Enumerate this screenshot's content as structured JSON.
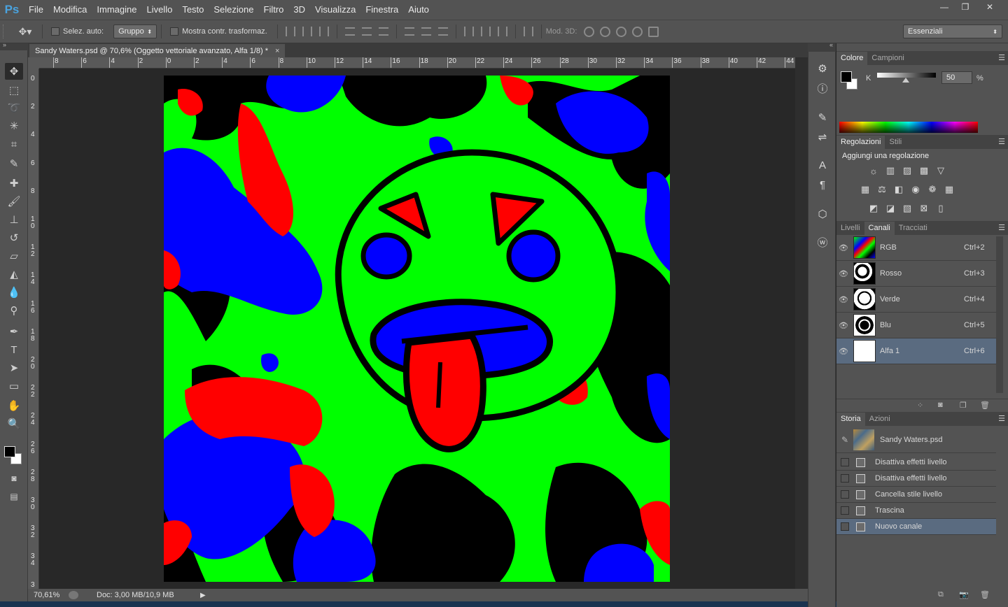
{
  "app": {
    "logo": "Ps"
  },
  "menubar": {
    "items": [
      "File",
      "Modifica",
      "Immagine",
      "Livello",
      "Testo",
      "Selezione",
      "Filtro",
      "3D",
      "Visualizza",
      "Finestra",
      "Aiuto"
    ]
  },
  "window_controls": {
    "minimize": "—",
    "restore": "❐",
    "close": "✕"
  },
  "options_bar": {
    "auto_select_label": "Selez. auto:",
    "auto_select_value": "Gruppo",
    "show_transform_label": "Mostra contr. trasformaz.",
    "mode_3d_label": "Mod. 3D:",
    "workspace_value": "Essenziali"
  },
  "document": {
    "tab_title": "Sandy Waters.psd @ 70,6% (Oggetto vettoriale avanzato, Alfa 1/8) *",
    "close_symbol": "×",
    "ruler_h": [
      "8",
      "6",
      "4",
      "2",
      "0",
      "2",
      "4",
      "6",
      "8",
      "10",
      "12",
      "14",
      "16",
      "18",
      "20",
      "22",
      "24",
      "26",
      "28",
      "30",
      "32",
      "34",
      "36",
      "38",
      "40",
      "42",
      "44"
    ],
    "ruler_v": [
      "0",
      "2",
      "4",
      "6",
      "8",
      "1\n0",
      "1\n2",
      "1\n4",
      "1\n6",
      "1\n8",
      "2\n0",
      "2\n2",
      "2\n4",
      "2\n6",
      "2\n8",
      "3\n0",
      "3\n2",
      "3\n4",
      "3"
    ]
  },
  "status_bar": {
    "zoom": "70,61%",
    "doc_info": "Doc: 3,00 MB/10,9 MB"
  },
  "color_panel": {
    "tabs": [
      "Colore",
      "Campioni"
    ],
    "channel_label": "K",
    "value": "50",
    "unit": "%"
  },
  "adjustments_panel": {
    "tabs": [
      "Regolazioni",
      "Stili"
    ],
    "heading": "Aggiungi una regolazione"
  },
  "layers_panel": {
    "tabs": [
      "Livelli",
      "Canali",
      "Tracciati"
    ],
    "channels": [
      {
        "name": "RGB",
        "shortcut": "Ctrl+2"
      },
      {
        "name": "Rosso",
        "shortcut": "Ctrl+3"
      },
      {
        "name": "Verde",
        "shortcut": "Ctrl+4"
      },
      {
        "name": "Blu",
        "shortcut": "Ctrl+5"
      },
      {
        "name": "Alfa 1",
        "shortcut": "Ctrl+6"
      }
    ]
  },
  "history_panel": {
    "tabs": [
      "Storia",
      "Azioni"
    ],
    "snapshot": "Sandy Waters.psd",
    "steps": [
      "Disattiva effetti livello",
      "Disattiva effetti livello",
      "Cancella stile livello",
      "Trascina",
      "Nuovo canale"
    ]
  },
  "colors": {
    "art_green": "#00ff00",
    "art_blue": "#0000ff",
    "art_red": "#ff0000",
    "art_black": "#000000",
    "selection": "#5a6b80"
  }
}
